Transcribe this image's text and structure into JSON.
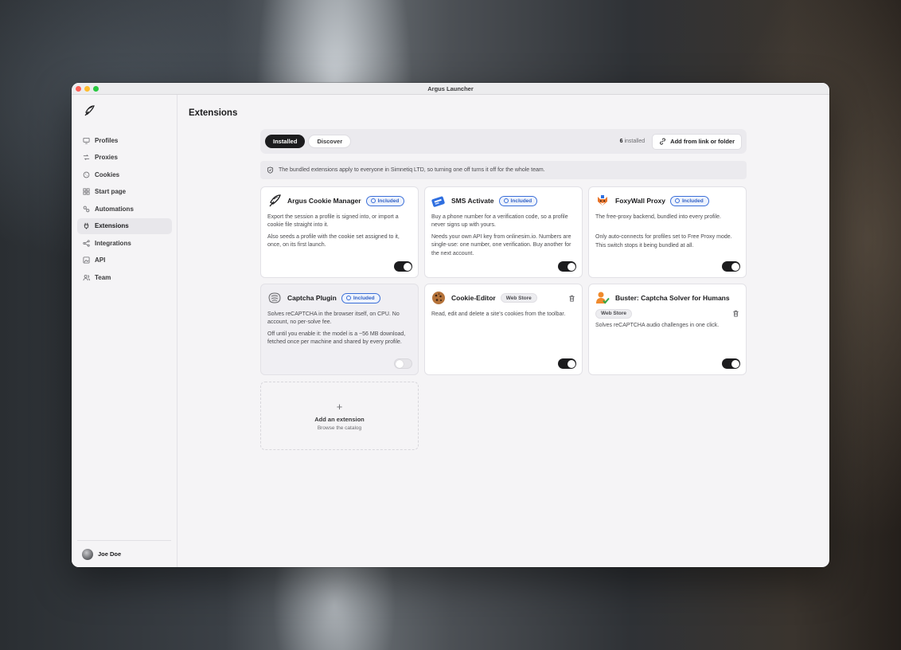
{
  "window": {
    "title": "Argus Launcher"
  },
  "sidebar": {
    "items": [
      {
        "label": "Profiles",
        "icon": "monitor-icon"
      },
      {
        "label": "Proxies",
        "icon": "route-icon"
      },
      {
        "label": "Cookies",
        "icon": "cookie-icon"
      },
      {
        "label": "Start page",
        "icon": "grid-icon"
      },
      {
        "label": "Automations",
        "icon": "link-icon"
      },
      {
        "label": "Extensions",
        "icon": "plug-icon",
        "active": true
      },
      {
        "label": "Integrations",
        "icon": "share-icon"
      },
      {
        "label": "API",
        "icon": "image-icon"
      },
      {
        "label": "Team",
        "icon": "users-icon"
      }
    ],
    "user": {
      "name": "Joe Doe"
    }
  },
  "page": {
    "title": "Extensions"
  },
  "toolbar": {
    "tabs": [
      "Installed",
      "Discover"
    ],
    "active_tab": "Installed",
    "installed_count": "6",
    "installed_suffix": " installed",
    "add_label": "Add from link or folder"
  },
  "notice": "The bundled extensions apply to everyone in Simnetiq LTD, so turning one off turns it off for the whole team.",
  "extensions": [
    {
      "name": "Argus Cookie Manager",
      "badge": "Included",
      "icon": "argus-logo-icon",
      "desc": [
        "Export the session a profile is signed into, or import a cookie file straight into it.",
        "Also seeds a profile with the cookie set assigned to it, once, on its first launch."
      ],
      "enabled": true
    },
    {
      "name": "SMS Activate",
      "badge": "Included",
      "icon": "sms-card-icon",
      "desc": [
        "Buy a phone number for a verification code, so a profile never signs up with yours.",
        "Needs your own API key from onlinesim.io. Numbers are single-use: one number, one verification. Buy another for the next account."
      ],
      "enabled": true
    },
    {
      "name": "FoxyWall Proxy",
      "badge": "Included",
      "icon": "fox-icon",
      "desc": [
        "The free-proxy backend, bundled into every profile.",
        "Only auto-connects for profiles set to Free Proxy mode. This switch stops it being bundled at all."
      ],
      "enabled": true
    },
    {
      "name": "Captcha Plugin",
      "badge": "Included",
      "icon": "captcha-icon",
      "desc": [
        "Solves reCAPTCHA in the browser itself, on CPU. No account, no per-solve fee.",
        "Off until you enable it: the model is a ~56 MB download, fetched once per machine and shared by every profile."
      ],
      "enabled": false
    },
    {
      "name": "Cookie-Editor",
      "badge": "Web Store",
      "icon": "cookie-editor-icon",
      "desc": [
        "Read, edit and delete a site's cookies from the toolbar."
      ],
      "enabled": true
    },
    {
      "name": "Buster: Captcha Solver for Humans",
      "badge": "Web Store",
      "icon": "buster-icon",
      "desc": [
        "Solves reCAPTCHA audio challenges in one click."
      ],
      "enabled": true
    }
  ],
  "add_extension": {
    "title": "Add an extension",
    "subtitle": "Browse the catalog"
  },
  "colors": {
    "accent_blue": "#3b6fd8",
    "toggle_on": "#1c1c1e",
    "toggle_off": "#e6e5e9"
  }
}
